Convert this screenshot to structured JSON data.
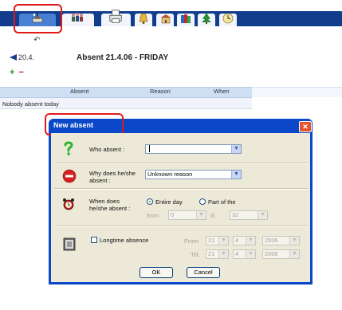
{
  "toolbar": {
    "icons": [
      "absence-icon",
      "people-icon",
      "printer-icon",
      "bell-icon",
      "building-icon",
      "books-icon",
      "tree-icon",
      "clock-icon"
    ]
  },
  "nav": {
    "undo_glyph": "↶",
    "date_prev": "20.4.",
    "title": "Absent 21.4.06 - FRIDAY",
    "add_glyph": "+",
    "remove_glyph": "−"
  },
  "table": {
    "columns": [
      "Absent",
      "Reason",
      "When"
    ],
    "empty_text": "Nobody absent today"
  },
  "dialog": {
    "title": "New absent",
    "close_glyph": "✕",
    "who": {
      "label": "Who absent :",
      "value": ""
    },
    "why": {
      "label_1": "Why does he/she",
      "label_2": "absent :",
      "value": "Unknown reason"
    },
    "when": {
      "label_1": "When does",
      "label_2": "he/she absent :",
      "entire_day": "Entire day",
      "part_of": "Part of the",
      "from_label": "from",
      "from_value": "0",
      "till_label": "til",
      "till_value": "32"
    },
    "longtime": {
      "label": "Longtime absence",
      "from_label": "From:",
      "till_label": "Till:",
      "from_day": "21",
      "from_month": "4",
      "from_year": "2006",
      "till_day": "21",
      "till_month": "4",
      "till_year": "2006"
    },
    "ok_label": "OK",
    "cancel_label": "Cancel"
  },
  "colors": {
    "toolbar_blue": "#113d8c",
    "dialog_blue": "#0b47c9",
    "highlight_red": "#e01a1a",
    "header_blue": "#cfe0f5"
  }
}
